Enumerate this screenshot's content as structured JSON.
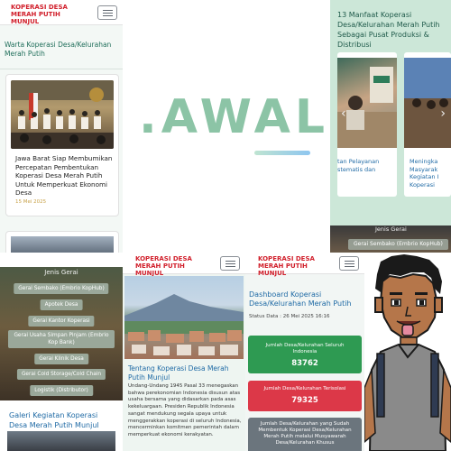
{
  "brand": "KOPERASI DESA\nMERAH PUTIH\nMUNJUL",
  "panel_news": {
    "heading": "Warta Koperasi Desa/Kelurahan Merah Putih",
    "card_title": "Jawa Barat Siap Membumikan Percepatan Pembentukan Koperasi Desa Merah Putih Untuk Memperkuat Ekonomi Desa",
    "card_date": "15 Mei 2025"
  },
  "logo": {
    "text": ".AWAL"
  },
  "panel_benefits": {
    "heading": "13 Manfaat Koperasi Desa/Kelurahan Merah Putih Sebagai Pusat Produksi & Distribusi",
    "slide_a_caption": "tan Pelayanan stematis dan",
    "slide_b_caption": "Meningka Masyarak Kegiatan I Koperasi",
    "jenis_label": "Jenis Gerai",
    "pill": "Gerai Sembako (Embrio KopHub)"
  },
  "panel_categories": {
    "jenis_label": "Jenis Gerai",
    "items": [
      "Gerai Sembako (Embrio KopHub)",
      "Apotek Desa",
      "Gerai Kantor Koperasi",
      "Gerai Usaha Simpan Pinjam (Embrio Kop Bank)",
      "Gerai Klinik Desa",
      "Gerai Cold Storage/Cold Chain",
      "Logistik (Distributor)"
    ],
    "gallery_title": "Galeri Kegiatan Koperasi Desa Merah Putih Munjul"
  },
  "panel_about": {
    "title": "Tentang Koperasi Desa Merah Putih Munjul",
    "body": "Undang-Undang 1945 Pasal 33 menegaskan bahwa perekonomian Indonesia disusun atas usaha bersama yang didasarkan pada asas kekeluargaan. Presiden Republik Indonesia sangat mendukung segala upaya untuk menggerakkan koperasi di seluruh Indonesia, mencerminkan komitmen pemerintah dalam memperkuat ekonomi kerakyatan."
  },
  "panel_dashboard": {
    "title": "Dashboard Koperasi Desa/Kelurahan Merah Putih",
    "status": "Status Data : 26 Mei 2025 16:16",
    "stats": [
      {
        "label": "Jumlah Desa/Kelurahan Seluruh Indonesia",
        "value": "83762"
      },
      {
        "label": "Jumlah Desa/Kelurahan Terisolasi",
        "value": "79325"
      },
      {
        "label": "Jumlah Desa/Kelurahan yang Sudah Membentuk Koperasi Desa/Kelurahan Merah Putih melalui Musyawarah Desa/Kelurahan Khusus",
        "value": ""
      }
    ]
  },
  "colors": {
    "brand_red": "#d11f2b",
    "heading_blue": "#1f6aa5",
    "logo_green": "#8cc4a6",
    "stat_green": "#2e9a52",
    "stat_red": "#dc3848",
    "stat_gray": "#6b757d"
  }
}
